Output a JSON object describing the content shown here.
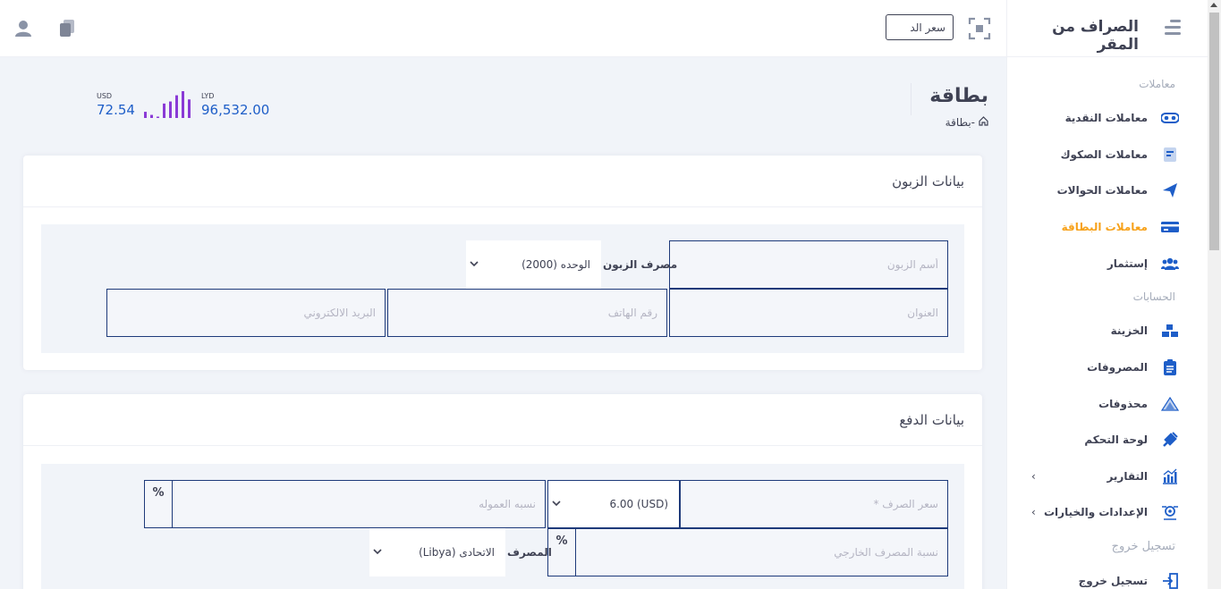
{
  "topbar": {
    "rate_placeholder": "سعر الد",
    "user_icon": "user-icon",
    "copy_icon": "copy-icon",
    "scan_icon": "scan-icon"
  },
  "sidebar": {
    "brand": "الصراف من المقر",
    "section_transactions": "معاملات",
    "section_accounts": "الحسابات",
    "section_logout": "تسجيل خروج",
    "items": [
      {
        "label": "معاملات النقدية",
        "icon": "cash-icon"
      },
      {
        "label": "معاملات الصكوك",
        "icon": "checks-icon"
      },
      {
        "label": "معاملات الحوالات",
        "icon": "send-icon"
      },
      {
        "label": "معاملات البطاقة",
        "icon": "card-icon",
        "active": true
      },
      {
        "label": "إستثمار",
        "icon": "investment-icon"
      },
      {
        "label": "الخزينة",
        "icon": "treasury-icon"
      },
      {
        "label": "المصروفات",
        "icon": "expenses-icon"
      },
      {
        "label": "محذوفات",
        "icon": "deleted-icon"
      },
      {
        "label": "لوحة التحكم",
        "icon": "dashboard-icon"
      },
      {
        "label": "التقارير",
        "icon": "reports-icon"
      },
      {
        "label": "الإعدادات والخيارات",
        "icon": "settings-icon"
      },
      {
        "label": "تسجيل خروج",
        "icon": "logout-icon"
      }
    ]
  },
  "page": {
    "title": "بطاقة",
    "breadcrumb": "-بطاقة"
  },
  "stats": {
    "lyd_label": "LYD",
    "lyd_value": "96,532.00",
    "usd_label": "USD",
    "usd_value": "72.54",
    "bars": [
      6,
      3,
      1,
      14,
      16,
      22,
      26,
      18
    ],
    "bar_color": "#8a3ad6"
  },
  "customer_card": {
    "title": "بيانات الزبون",
    "name_placeholder": "أسم الزبون",
    "bank_label": "مصرف الزبون",
    "bank_value": "الوحده (2000)",
    "address_placeholder": "العنوان",
    "phone_placeholder": "رقم الهاتف",
    "email_placeholder": "البريد الالكتروني"
  },
  "payment_card": {
    "title": "بيانات الدفع",
    "rate_placeholder": "سعر الصرف *",
    "currency_value": "(USD) 6.00",
    "commission_placeholder": "نسبه العموله",
    "pct_symbol": "%",
    "external_bank_placeholder": "نسبة المصرف الخارجي",
    "bank_label": "المصرف",
    "bank_value": "الاتحادى (Libya)"
  },
  "colors": {
    "accent": "#1e5ec8",
    "active_nav": "#f7a21b",
    "border": "#1e3a7a"
  }
}
